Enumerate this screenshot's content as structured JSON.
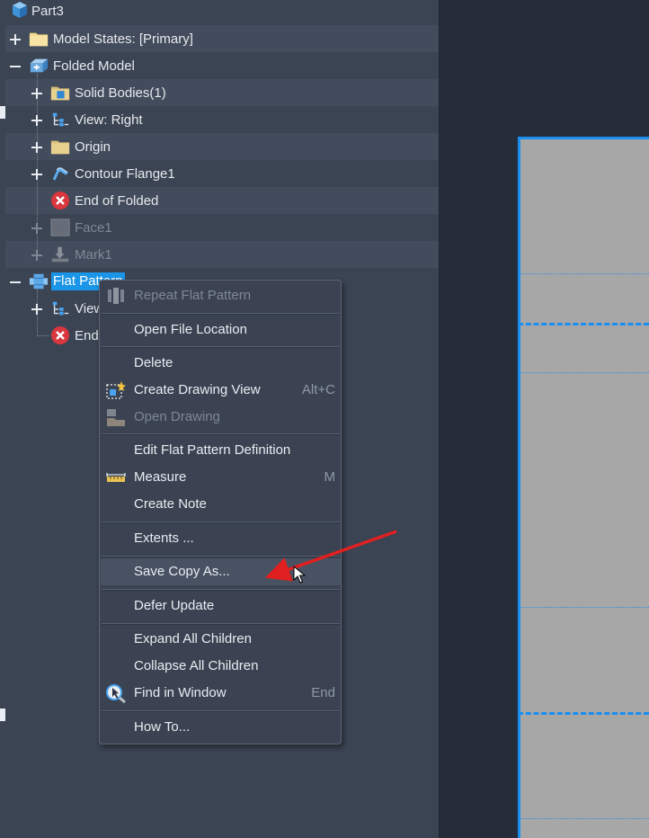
{
  "tree": {
    "root": {
      "label": "Part3",
      "icon": "part-icon"
    },
    "items": [
      {
        "label": "Model States: [Primary]",
        "icon": "folder-icon"
      },
      {
        "label": "Folded Model",
        "icon": "folded-model-icon"
      },
      {
        "label": "Solid Bodies(1)",
        "icon": "solid-bodies-folder-icon"
      },
      {
        "label": "View: Right",
        "icon": "view-icon"
      },
      {
        "label": "Origin",
        "icon": "folder-icon"
      },
      {
        "label": "Contour Flange1",
        "icon": "contour-flange-icon"
      },
      {
        "label": "End of Folded",
        "icon": "end-of-part-icon"
      },
      {
        "label": "Face1",
        "icon": "face-icon"
      },
      {
        "label": "Mark1",
        "icon": "mark-icon"
      },
      {
        "label": "Flat Pattern",
        "icon": "flat-pattern-icon"
      },
      {
        "label": "View",
        "icon": "view-icon"
      },
      {
        "label": "End",
        "icon": "end-of-part-icon"
      }
    ]
  },
  "context_menu": {
    "items": [
      {
        "label": "Repeat Flat Pattern",
        "shortcut": "",
        "disabled": true,
        "icon": "repeat-icon"
      },
      {
        "label": "Open File Location",
        "shortcut": ""
      },
      {
        "label": "Delete",
        "shortcut": ""
      },
      {
        "label": "Create Drawing View",
        "shortcut": "Alt+C",
        "icon": "drawing-view-icon"
      },
      {
        "label": "Open Drawing",
        "shortcut": "",
        "disabled": true,
        "icon": "open-drawing-icon"
      },
      {
        "label": "Edit Flat Pattern Definition",
        "shortcut": ""
      },
      {
        "label": "Measure",
        "shortcut": "M",
        "icon": "ruler-icon"
      },
      {
        "label": "Create Note",
        "shortcut": ""
      },
      {
        "label": "Extents ...",
        "shortcut": ""
      },
      {
        "label": "Save Copy As...",
        "shortcut": "",
        "highlighted": true
      },
      {
        "label": "Defer Update",
        "shortcut": ""
      },
      {
        "label": "Expand All Children",
        "shortcut": ""
      },
      {
        "label": "Collapse All Children",
        "shortcut": ""
      },
      {
        "label": "Find in Window",
        "shortcut": "End",
        "icon": "find-in-window-icon"
      },
      {
        "label": "How To...",
        "shortcut": ""
      }
    ]
  },
  "colors": {
    "selection": "#1b95e8",
    "annotation_arrow": "#e02020",
    "sheet": "#a7a7a7",
    "sketch_line": "#1a8ff0"
  }
}
